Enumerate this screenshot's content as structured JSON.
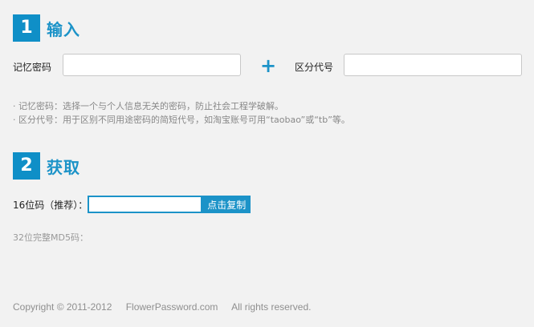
{
  "section1": {
    "number": "1",
    "title": "输入"
  },
  "inputs": {
    "memory_label": "记忆密码",
    "memory_value": "",
    "plus": "+",
    "code_label": "区分代号",
    "code_value": ""
  },
  "hints": [
    "· 记忆密码：选择一个与个人信息无关的密码，防止社会工程学破解。",
    "· 区分代号：用于区别不同用途密码的简短代号，如淘宝账号可用“taobao”或“tb”等。"
  ],
  "section2": {
    "number": "2",
    "title": "获取"
  },
  "result": {
    "label16": "16位码（推荐）：",
    "value16": "",
    "copy_label": "点击复制",
    "label32": "32位完整MD5码："
  },
  "footer": {
    "copyright": "Copyright © 2011-2012",
    "site": "FlowerPassword.com",
    "rights": "All rights reserved."
  },
  "colors": {
    "accent": "#1c93c8",
    "background": "#f2f2f2"
  }
}
